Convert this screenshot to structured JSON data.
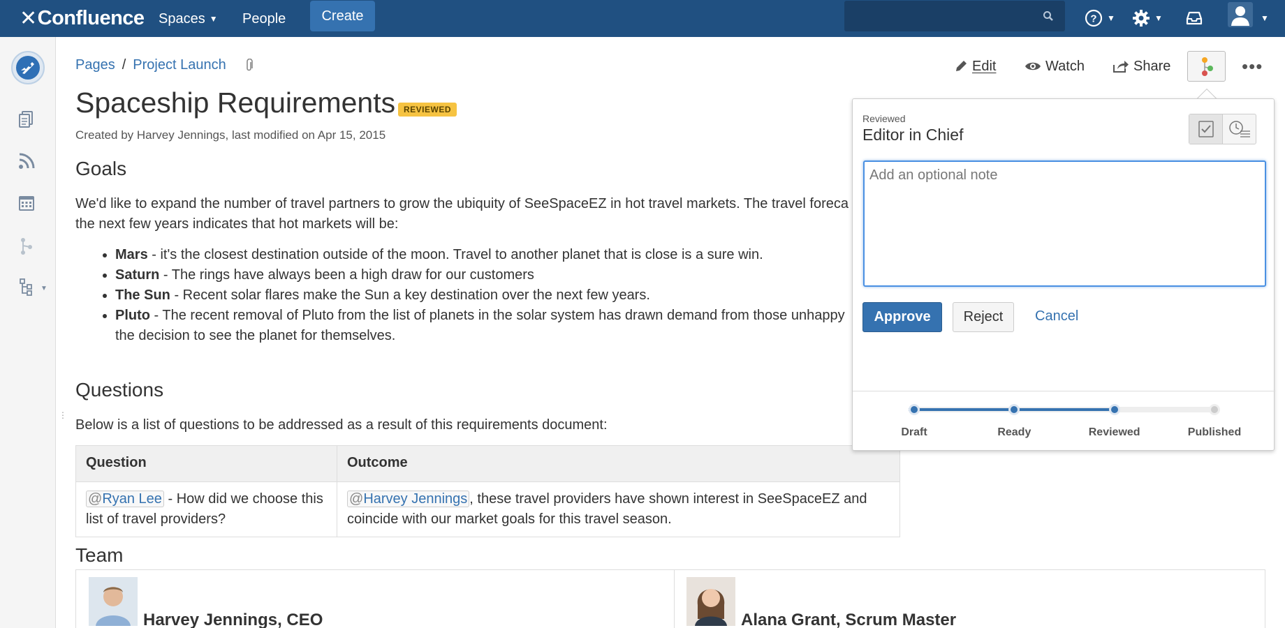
{
  "header": {
    "logo_text": "Confluence",
    "nav": {
      "spaces": "Spaces",
      "people": "People",
      "create": "Create"
    },
    "search_placeholder": "",
    "colors": {
      "bar": "#205081",
      "create_button": "#3572b0"
    }
  },
  "sidebar": {
    "items": [
      "pages-icon",
      "blog-icon",
      "calendar-icon",
      "workflow-icon",
      "tree-icon"
    ]
  },
  "breadcrumb": {
    "root": "Pages",
    "separator": "/",
    "parent": "Project Launch"
  },
  "toolbar": {
    "edit": "Edit",
    "watch": "Watch",
    "share": "Share",
    "more": "•••"
  },
  "page": {
    "title": "Spaceship Requirements",
    "status": "REVIEWED",
    "byline": "Created by Harvey Jennings, last modified on Apr 15, 2015",
    "goals": {
      "heading": "Goals",
      "intro_line1": "We'd like to expand the number of travel partners to grow the ubiquity of SeeSpaceEZ in hot travel markets.  The travel foreca",
      "intro_line2": "the next few years indicates that hot markets will be:",
      "bullets": [
        {
          "term": "Mars",
          "text": " - it's the closest destination outside of the moon.  Travel to another planet that is close is a sure win."
        },
        {
          "term": "Saturn",
          "text": " - The rings have always been a high draw for our customers"
        },
        {
          "term": "The Sun",
          "text": " - Recent solar flares make the Sun a key destination over the next few years."
        },
        {
          "term": "Pluto",
          "text": " - The recent removal of Pluto from the list of planets in the solar system has drawn demand from those unhappy",
          "text2": "the decision to see the planet for themselves."
        }
      ]
    },
    "questions": {
      "heading": "Questions",
      "intro": "Below is a list of questions to be addressed as a result of this requirements document:",
      "columns": [
        "Question",
        "Outcome"
      ],
      "rows": [
        {
          "q_mention": "Ryan Lee",
          "q_text": " - How did we choose this list of travel providers?",
          "o_mention": "Harvey Jennings",
          "o_text": ", these travel providers have shown interest in SeeSpaceEZ and coincide with our market goals for this travel season."
        }
      ]
    },
    "team": {
      "heading": "Team",
      "members": [
        "Harvey Jennings, CEO",
        "Alana Grant, Scrum Master"
      ]
    }
  },
  "workflow_popup": {
    "state": "Reviewed",
    "role": "Editor in Chief",
    "note_placeholder": "Add an optional note",
    "approve": "Approve",
    "reject": "Reject",
    "cancel": "Cancel",
    "stages": [
      "Draft",
      "Ready",
      "Reviewed",
      "Published"
    ],
    "current_stage_index": 2
  }
}
